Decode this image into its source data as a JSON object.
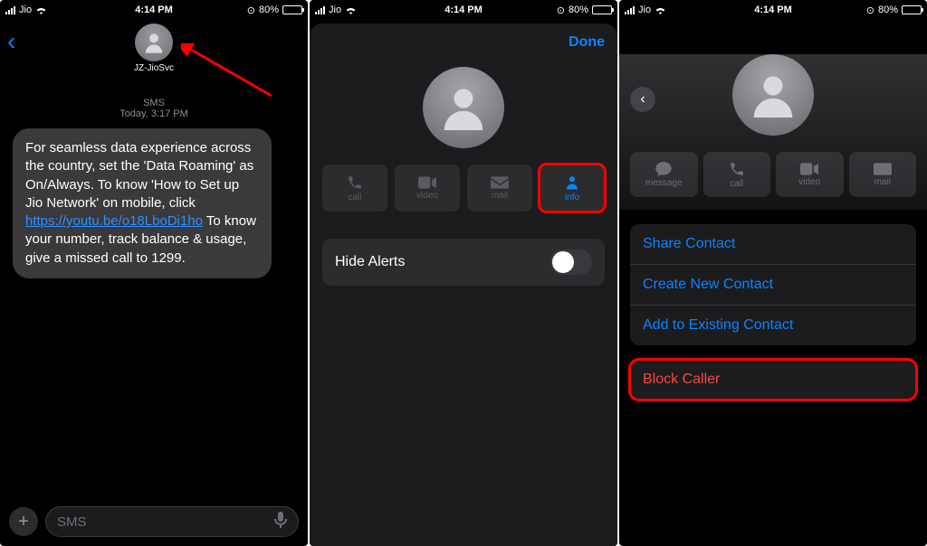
{
  "status": {
    "carrier": "Jio",
    "time": "4:14 PM",
    "battery_pct": "80%",
    "battery_fill_pct": 80
  },
  "screen1": {
    "contact_name": "JZ-JioSvc",
    "thread_type": "SMS",
    "thread_time": "Today, 3:17 PM",
    "message_part1": "For seamless data experience across the country, set the 'Data Roaming' as On/Always. To know 'How to Set up Jio Network' on mobile, click ",
    "message_link": "https://youtu.be/o18LboDi1ho",
    "message_part2": " To know your number, track balance & usage, give a missed call to 1299.",
    "compose_placeholder": "SMS"
  },
  "screen2": {
    "done": "Done",
    "actions": {
      "call": "call",
      "video": "video",
      "mail": "mail",
      "info": "info"
    },
    "hide_alerts": "Hide Alerts",
    "hide_alerts_on": false
  },
  "screen3": {
    "actions": {
      "message": "message",
      "call": "call",
      "video": "video",
      "mail": "mail"
    },
    "share_contact": "Share Contact",
    "create_new": "Create New Contact",
    "add_existing": "Add to Existing Contact",
    "block_caller": "Block Caller"
  }
}
